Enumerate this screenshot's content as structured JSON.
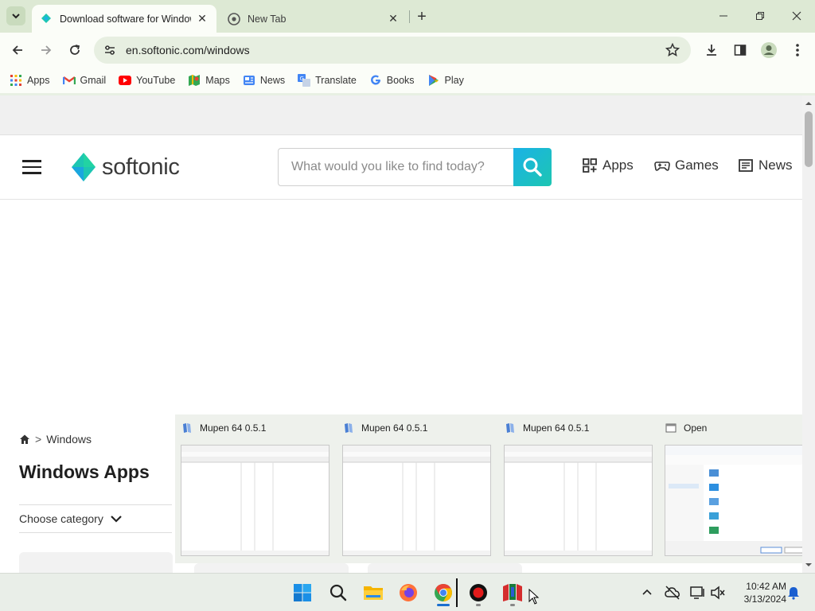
{
  "browser": {
    "tabs": [
      {
        "title": "Download software for Windows",
        "active": true
      },
      {
        "title": "New Tab",
        "active": false
      }
    ],
    "url": "en.softonic.com/windows",
    "bookmarks": [
      "Apps",
      "Gmail",
      "YouTube",
      "Maps",
      "News",
      "Translate",
      "Books",
      "Play"
    ]
  },
  "site": {
    "logo_text": "softonic",
    "search_placeholder": "What would you like to find today?",
    "nav": [
      "Apps",
      "Games",
      "News"
    ],
    "breadcrumb_sep": ">",
    "breadcrumb": "Windows",
    "title": "Windows Apps",
    "choose_category": "Choose category"
  },
  "thumbnails": [
    {
      "title": "Mupen 64  0.5.1"
    },
    {
      "title": "Mupen 64  0.5.1"
    },
    {
      "title": "Mupen 64  0.5.1"
    },
    {
      "title": "Open"
    }
  ],
  "taskbar": {
    "time": "10:42 AM",
    "date": "3/13/2024"
  },
  "colors": {
    "accent_teal": "#1dc6b2",
    "accent_blue": "#1ab2e6",
    "chrome_frame": "#dde9d4"
  }
}
